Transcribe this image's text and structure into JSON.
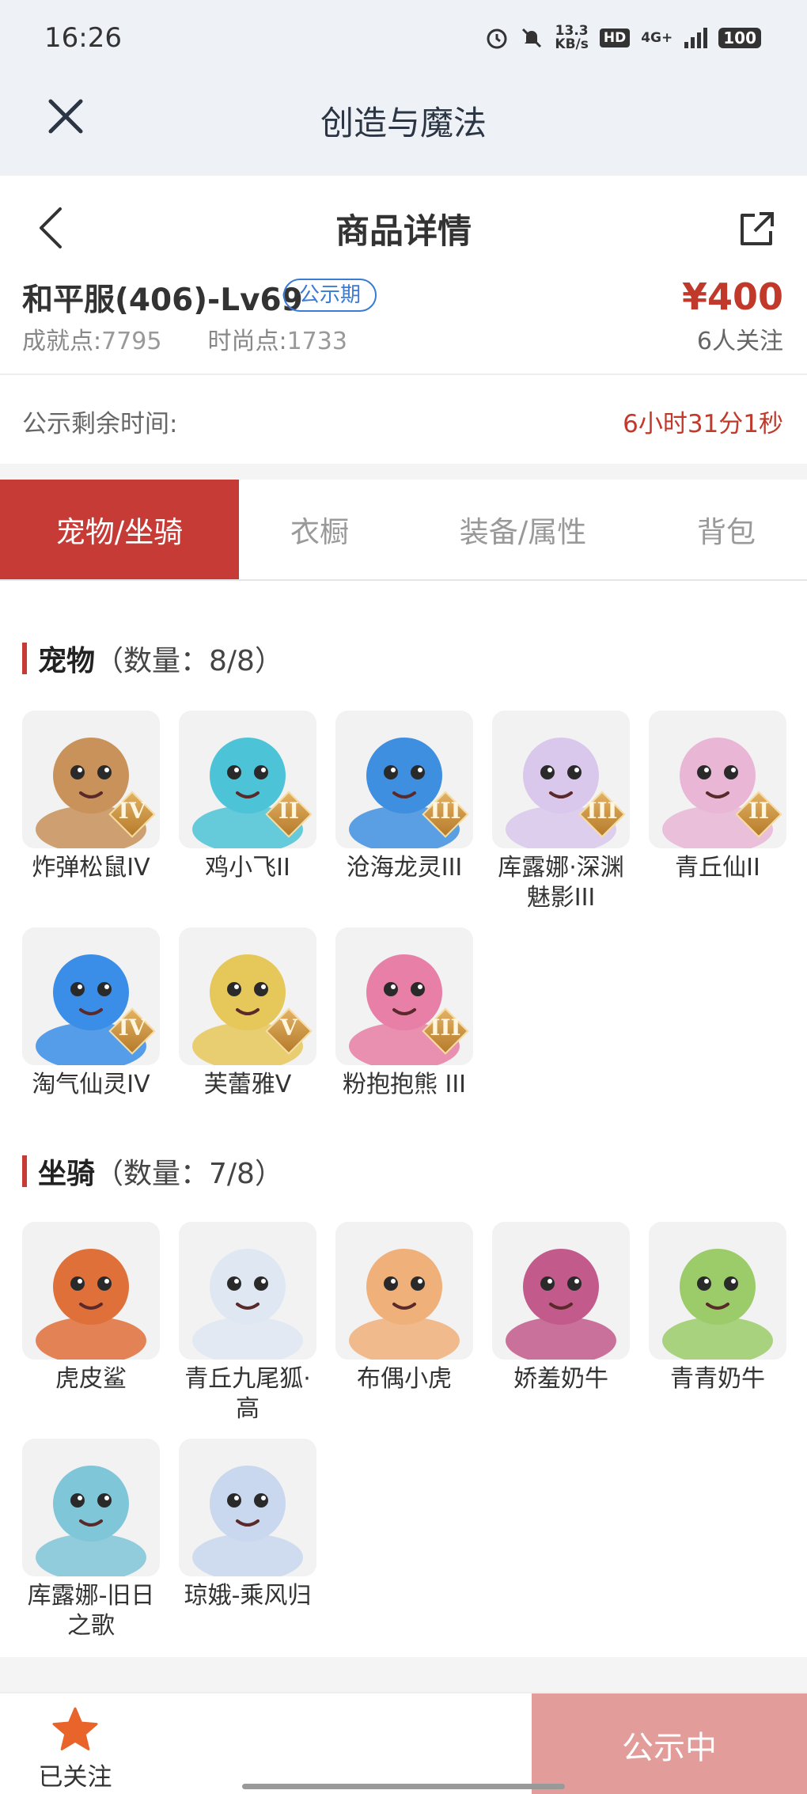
{
  "status_bar": {
    "time": "16:26",
    "speed_value": "13.3",
    "speed_unit": "KB/s",
    "hd": "HD",
    "network": "4G+",
    "battery": "100",
    "icons": [
      "alarm-icon",
      "mute-icon",
      "signal-icon"
    ]
  },
  "app_bar": {
    "title": "创造与魔法",
    "close_icon": "close-icon"
  },
  "header": {
    "title": "商品详情",
    "back_icon": "chevron-left-icon",
    "share_icon": "share-icon"
  },
  "product": {
    "name": "和平服(406)-Lv69",
    "status": "公示期",
    "price": "¥400",
    "achievement_label": "成就点:",
    "achievement_value": "7795",
    "fashion_label": "时尚点:",
    "fashion_value": "1733",
    "followers": "6人关注"
  },
  "countdown": {
    "label": "公示剩余时间:",
    "value": "6小时31分1秒"
  },
  "tabs": [
    {
      "label": "宠物/坐骑",
      "active": true
    },
    {
      "label": "衣橱",
      "active": false
    },
    {
      "label": "装备/属性",
      "active": false
    },
    {
      "label": "背包",
      "active": false
    }
  ],
  "pets": {
    "title": "宠物",
    "count": "（数量：8/8）",
    "items": [
      {
        "name": "炸弹松鼠IV",
        "grade": "IV",
        "color": "#c8925a"
      },
      {
        "name": "鸡小飞II",
        "grade": "II",
        "color": "#4cc3d6"
      },
      {
        "name": "沧海龙灵III",
        "grade": "III",
        "color": "#3f8fe0"
      },
      {
        "name": "库露娜·深渊魅影III",
        "grade": "III",
        "color": "#d9c8ec"
      },
      {
        "name": "青丘仙II",
        "grade": "II",
        "color": "#e9b6d6"
      },
      {
        "name": "淘气仙灵IV",
        "grade": "IV",
        "color": "#3a8ee8"
      },
      {
        "name": "芙蕾雅V",
        "grade": "V",
        "color": "#e6c75a"
      },
      {
        "name": "粉抱抱熊 III",
        "grade": "III",
        "color": "#e77fa6"
      }
    ]
  },
  "mounts": {
    "title": "坐骑",
    "count": "（数量：7/8）",
    "items": [
      {
        "name": "虎皮鲨",
        "color": "#e0703a"
      },
      {
        "name": "青丘九尾狐·高",
        "color": "#dfe8f2"
      },
      {
        "name": "布偶小虎",
        "color": "#f0b07a"
      },
      {
        "name": "娇羞奶牛",
        "color": "#c25a8c"
      },
      {
        "name": "青青奶牛",
        "color": "#9ccc6a"
      },
      {
        "name": "库露娜-旧日之歌",
        "color": "#7fc6d8"
      },
      {
        "name": "琼娥-乘风归",
        "color": "#c9d8ee"
      }
    ]
  },
  "bottom": {
    "follow_label": "已关注",
    "action_label": "公示中",
    "star_icon": "star-icon"
  }
}
